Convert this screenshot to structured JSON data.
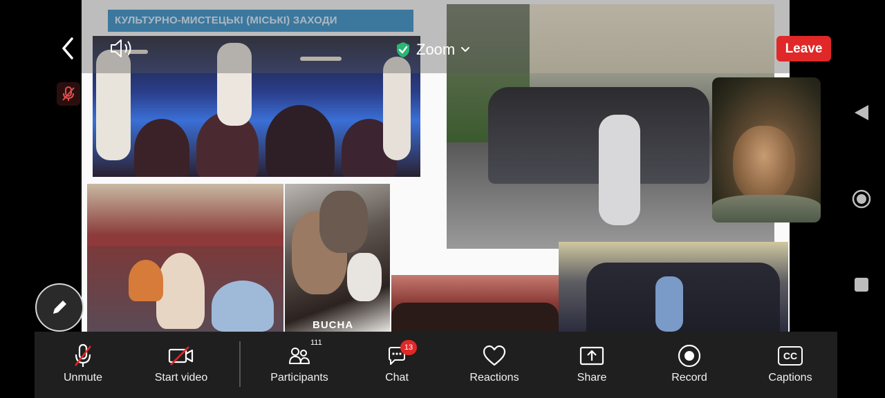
{
  "app": {
    "name": "Zoom",
    "accent_color": "#e02828",
    "verified_color": "#2bb673"
  },
  "topbar": {
    "back_icon": "chevron-left-icon",
    "speaker_icon": "speaker-icon",
    "meeting_title": "Zoom",
    "title_dropdown_icon": "chevron-down-icon",
    "leave_label": "Leave"
  },
  "slide": {
    "title": "КУЛЬТУРНО-МИСТЕЦЬКІ (МІСЬКІ) ЗАХОДИ",
    "poster_text": "BUCHA"
  },
  "toolbar": {
    "unmute_label": "Unmute",
    "start_video_label": "Start video",
    "participants_label": "Participants",
    "participants_count": "111",
    "chat_label": "Chat",
    "chat_badge": "13",
    "reactions_label": "Reactions",
    "share_label": "Share",
    "record_label": "Record",
    "captions_label": "Captions",
    "captions_icon_text": "CC"
  },
  "navbar": {
    "back_icon": "triangle-back-icon",
    "home_icon": "circle-home-icon",
    "recents_icon": "square-recents-icon"
  }
}
